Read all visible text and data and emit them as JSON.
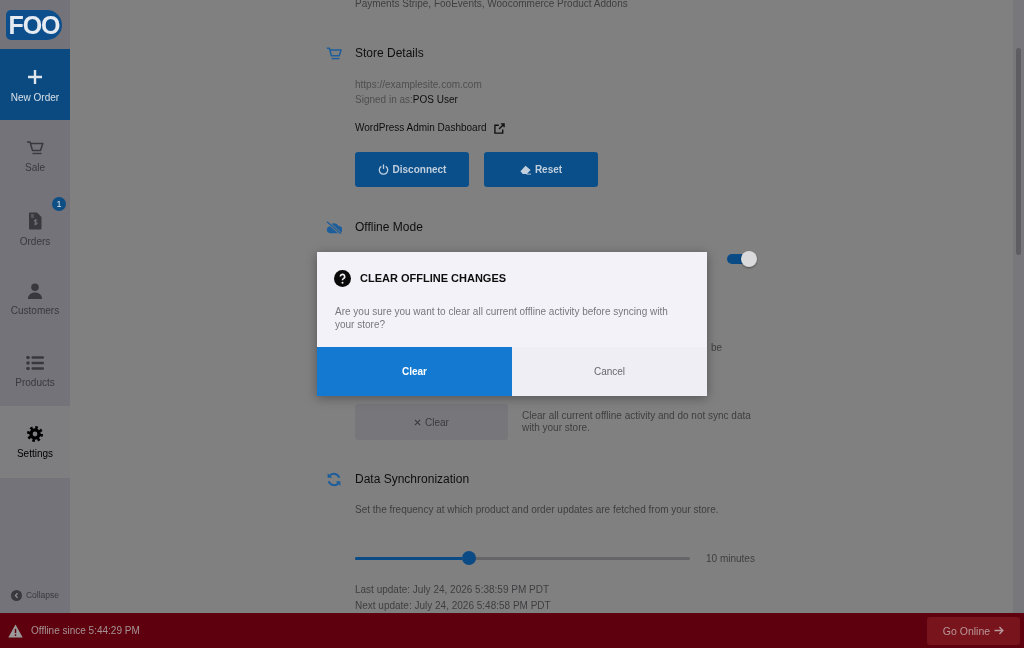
{
  "sidebar": {
    "logo": "FOO",
    "new_order": {
      "label": "New Order"
    },
    "items": [
      {
        "label": "Sale",
        "selected": false
      },
      {
        "label": "Orders",
        "selected": false,
        "badge": "1"
      },
      {
        "label": "Customers",
        "selected": false
      },
      {
        "label": "Products",
        "selected": false
      },
      {
        "label": "Settings",
        "selected": true
      }
    ],
    "collapse": {
      "label": "Collapse"
    }
  },
  "settings": {
    "plugins_text": "Payments Stripe, FooEvents, Woocommerce Product Addons",
    "store_details": {
      "title": "Store Details",
      "url": "https://examplesite.com.com",
      "signed_in": {
        "label": "Signed in as:",
        "value": "POS User"
      },
      "admin_link": "WordPress Admin Dashboard",
      "buttons": [
        "Disconnect",
        "Reset"
      ]
    },
    "offline_mode": {
      "title": "Offline Mode",
      "toggle": {
        "on": true
      },
      "text_fragment": "be",
      "clear_button": "Clear",
      "clear_description": "Clear all current offline activity and do not sync data with your store."
    },
    "data_sync": {
      "title": "Data Synchronization",
      "description": "Set the frequency at which product and order updates are fetched from your store.",
      "slider": {
        "level": 0.34,
        "reading": "10 minutes"
      },
      "last_update": "Last update: July 24, 2026 5:38:59 PM PDT",
      "next_update": "Next update: July 24, 2026 5:48:58 PM PDT"
    }
  },
  "dialog": {
    "title": "CLEAR OFFLINE CHANGES",
    "message": "Are you sure you want to clear all current offline activity before syncing with your store?",
    "buttons": [
      {
        "label": "Clear",
        "kind": "primary"
      },
      {
        "label": "Cancel",
        "kind": "secondary"
      }
    ]
  },
  "status_bar": {
    "text": "Offline since 5:44:29 PM",
    "button": "Go Online"
  }
}
